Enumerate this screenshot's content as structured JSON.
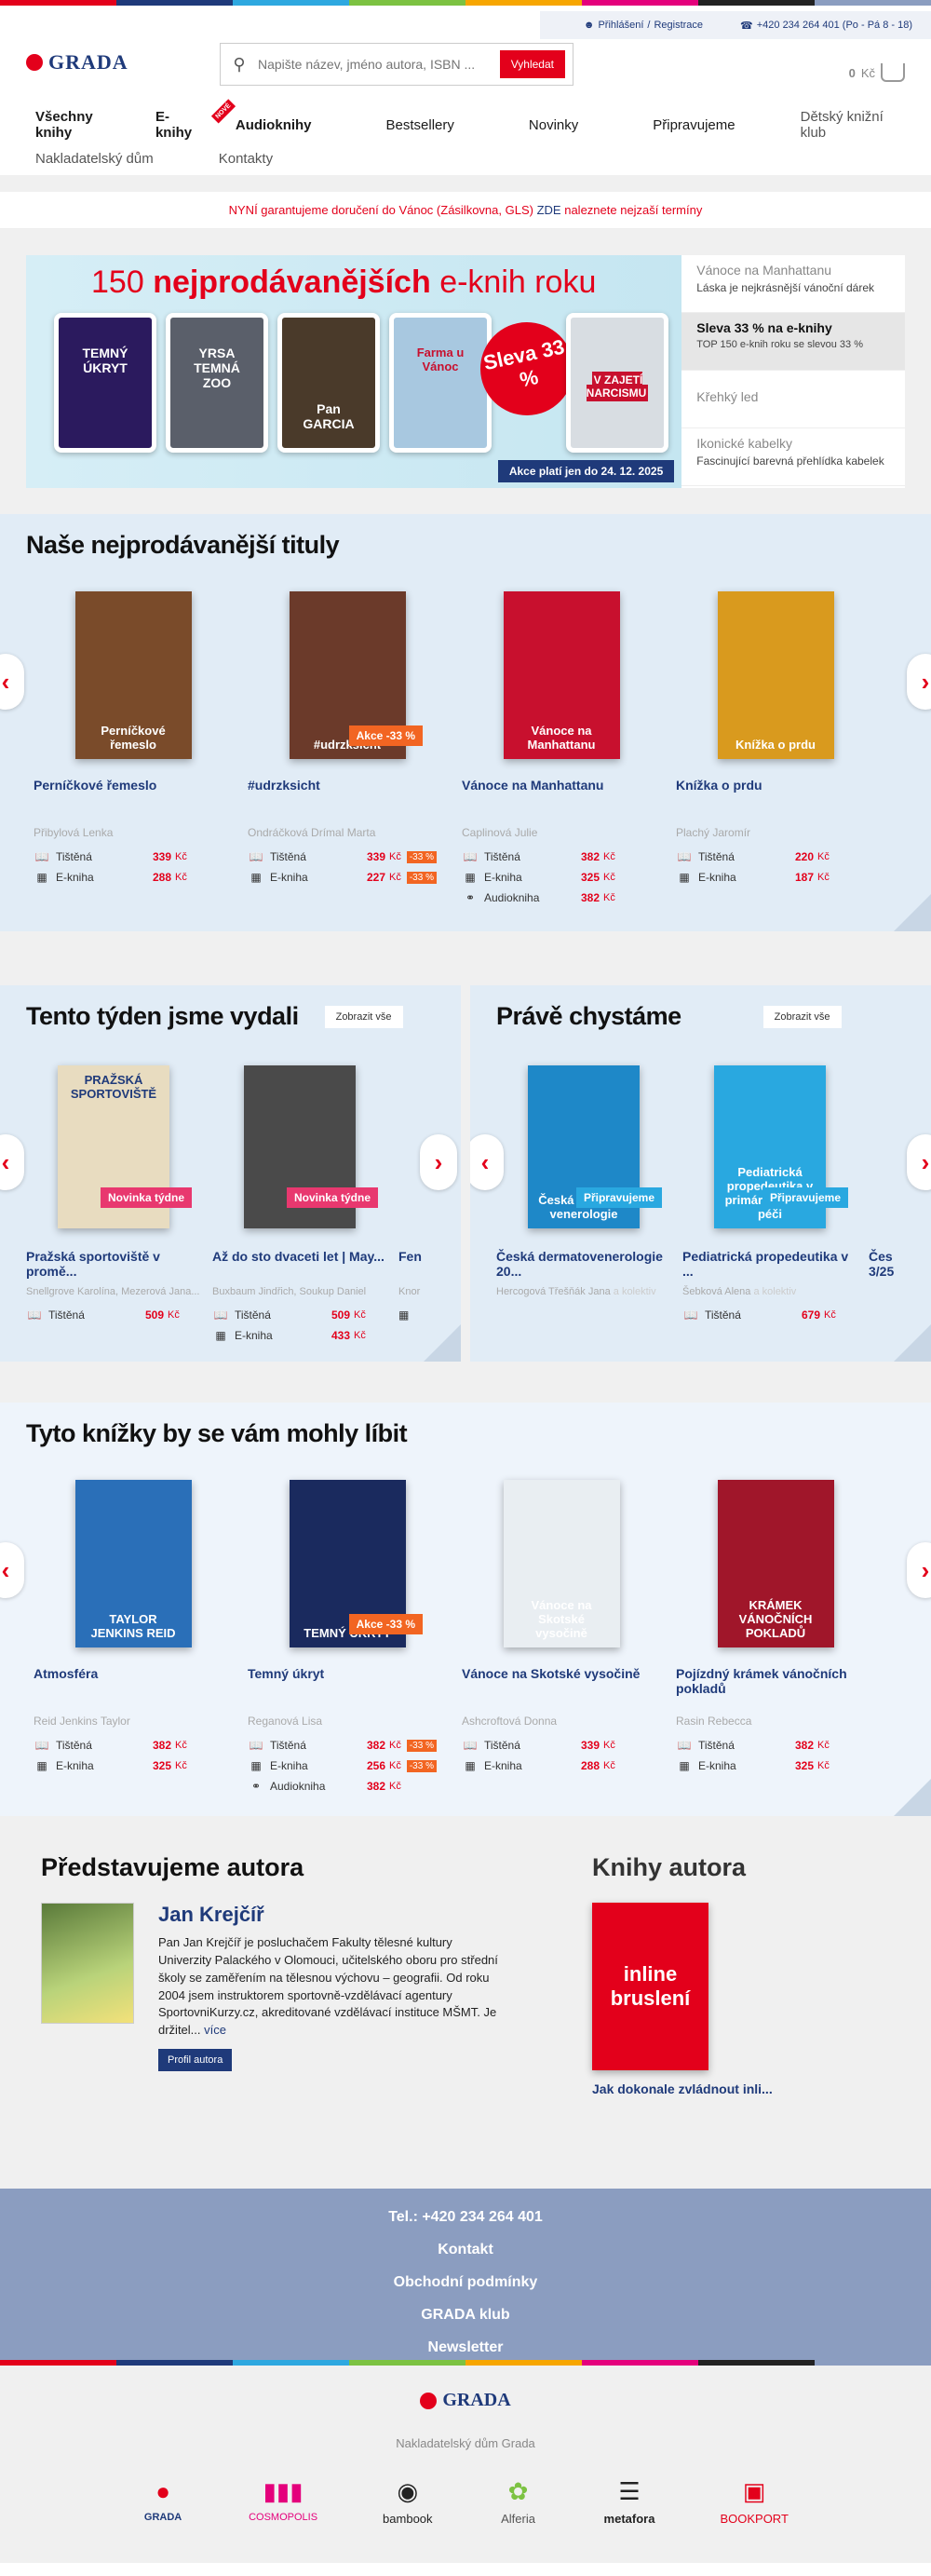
{
  "top": {
    "login": "Přihlášení",
    "separator": "/",
    "register": "Registrace",
    "phone": "+420 234 264 401 (Po - Pá 8 - 18)"
  },
  "header": {
    "logo": "GRADA",
    "search_placeholder": "Napište název, jméno autora, ISBN ...",
    "search_button": "Vyhledat",
    "cart_amount": "0",
    "cart_currency": "Kč"
  },
  "nav": {
    "row1": [
      "Všechny knihy",
      "E-knihy",
      "Audioknihy",
      "Bestsellery",
      "Novinky",
      "Připravujeme",
      "Dětský knižní klub"
    ],
    "new_badge": "NOVÉ",
    "row2": [
      "Nakladatelský dům",
      "Kontakty"
    ]
  },
  "notice": {
    "text": "NYNÍ garantujeme doručení do Vánoc (Zásilkovna, GLS)",
    "link": "ZDE",
    "rest": "naleznete nejzaší termíny"
  },
  "hero": {
    "title_pre": "150",
    "title_bold": "nejprodávanějších",
    "title_post": "e-knih roku",
    "badge": "Sleva 33 %",
    "note": "Akce platí jen do 24. 12. 2025",
    "books": [
      "TEMNÝ ÚKRYT",
      "YRSA TEMNÁ ZOO",
      "Pan GARCIA",
      "Farma u Vánoc",
      "V ZAJETÍ NARCISMU"
    ],
    "tabs": [
      {
        "title": "Vánoce na Manhattanu",
        "sub": "Láska je nejkrásnější vánoční dárek"
      },
      {
        "title": "Sleva 33 % na e-knihy",
        "sub": "TOP 150 e-knih roku se slevou 33 %"
      },
      {
        "title": "Křehký led",
        "sub": ""
      },
      {
        "title": "Ikonické kabelky",
        "sub": "Fascinující barevná přehlídka kabelek"
      }
    ]
  },
  "bestsellers": {
    "heading": "Naše nejprodávanější tituly",
    "items": [
      {
        "title": "Perníčkové řemeslo",
        "author": "Přibylová Lenka",
        "cover_text": "Perníčkové řemeslo",
        "color": "#7a4b2a",
        "akce": "",
        "prices": [
          {
            "type": "Tištěná",
            "price": "339",
            "disc": ""
          },
          {
            "type": "E-kniha",
            "price": "288",
            "disc": ""
          }
        ]
      },
      {
        "title": "#udrzksicht",
        "author": "Ondráčková Drímal Marta",
        "cover_text": "#udrzksicht",
        "color": "#6b3a2a",
        "akce": "Akce -33 %",
        "prices": [
          {
            "type": "Tištěná",
            "price": "339",
            "disc": "-33 %"
          },
          {
            "type": "E-kniha",
            "price": "227",
            "disc": "-33 %"
          }
        ]
      },
      {
        "title": "Vánoce na Manhattanu",
        "author": "Caplinová Julie",
        "cover_text": "Vánoce na Manhattanu",
        "color": "#c8102e",
        "akce": "",
        "prices": [
          {
            "type": "Tištěná",
            "price": "382",
            "disc": ""
          },
          {
            "type": "E-kniha",
            "price": "325",
            "disc": ""
          },
          {
            "type": "Audiokniha",
            "price": "382",
            "disc": ""
          }
        ]
      },
      {
        "title": "Knížka o prdu",
        "author": "Plachý Jaromír",
        "cover_text": "Knížka o prdu",
        "color": "#d99a1e",
        "akce": "",
        "prices": [
          {
            "type": "Tištěná",
            "price": "220",
            "disc": ""
          },
          {
            "type": "E-kniha",
            "price": "187",
            "disc": ""
          }
        ]
      }
    ]
  },
  "this_week": {
    "heading": "Tento týden jsme vydali",
    "button": "Zobrazit vše",
    "tag": "Novinka týdne",
    "items": [
      {
        "title": "Pražská sportoviště v promě...",
        "author": "Snellgrove Karolína, Mezerová Jana...",
        "cover_text": "PRAŽSKÁ SPORTOVIŠTĚ",
        "color": "#e8dcc0",
        "prices": [
          {
            "type": "Tištěná",
            "price": "509"
          }
        ]
      },
      {
        "title": "Až do sto dvaceti let | May...",
        "author": "Buxbaum Jindřich, Soukup Daniel",
        "cover_text": "",
        "color": "#4a4a4a",
        "prices": [
          {
            "type": "Tištěná",
            "price": "509"
          },
          {
            "type": "E-kniha",
            "price": "433"
          }
        ]
      },
      {
        "title": "Fen",
        "author": "Knor",
        "cover_text": "",
        "color": "#999",
        "prices": [
          {
            "type": "",
            "price": ""
          }
        ]
      }
    ]
  },
  "upcoming": {
    "heading": "Právě chystáme",
    "button": "Zobrazit vše",
    "tag": "Připravujeme",
    "items": [
      {
        "title": "Česká dermatovenerologie 20...",
        "author_main": "Hercogová Třešňák Jana",
        "author_more": "a kolektiv",
        "cover_text": "Česká dermato-venerologie",
        "color": "#1e88c8",
        "prices": []
      },
      {
        "title": "Pediatrická propedeutika v ...",
        "author_main": "Šebková Alena",
        "author_more": "a kolektiv",
        "cover_text": "Pediatrická propedeutika v primární dětské péči",
        "color": "#29a8e0",
        "prices": [
          {
            "type": "Tištěná",
            "price": "679"
          }
        ]
      },
      {
        "title": "Čes 3/25",
        "author_main": "",
        "author_more": "",
        "cover_text": "",
        "color": "#999",
        "prices": []
      }
    ]
  },
  "recommended": {
    "heading": "Tyto knížky by se vám mohly líbit",
    "items": [
      {
        "title": "Atmosféra",
        "author": "Reid Jenkins Taylor",
        "cover_text": "TAYLOR JENKINS REID",
        "color": "#2a6fb8",
        "akce": "",
        "prices": [
          {
            "type": "Tištěná",
            "price": "382",
            "disc": ""
          },
          {
            "type": "E-kniha",
            "price": "325",
            "disc": ""
          }
        ]
      },
      {
        "title": "Temný úkryt",
        "author": "Reganová Lisa",
        "cover_text": "TEMNÝ ÚKRYT",
        "color": "#1a2a5e",
        "akce": "Akce -33 %",
        "prices": [
          {
            "type": "Tištěná",
            "price": "382",
            "disc": "-33 %"
          },
          {
            "type": "E-kniha",
            "price": "256",
            "disc": "-33 %"
          },
          {
            "type": "Audiokniha",
            "price": "382",
            "disc": ""
          }
        ]
      },
      {
        "title": "Vánoce na Skotské vysočině",
        "author": "Ashcroftová Donna",
        "cover_text": "Vánoce na Skotské vysočině",
        "color": "#e9eef2",
        "akce": "",
        "prices": [
          {
            "type": "Tištěná",
            "price": "339",
            "disc": ""
          },
          {
            "type": "E-kniha",
            "price": "288",
            "disc": ""
          }
        ]
      },
      {
        "title": "Pojízdný krámek vánočních pokladů",
        "author": "Rasin Rebecca",
        "cover_text": "KRÁMEK VÁNOČNÍCH POKLADŮ",
        "color": "#a0162a",
        "akce": "",
        "prices": [
          {
            "type": "Tištěná",
            "price": "382",
            "disc": ""
          },
          {
            "type": "E-kniha",
            "price": "325",
            "disc": ""
          }
        ]
      }
    ]
  },
  "author": {
    "heading": "Představujeme autora",
    "name": "Jan Krejčíř",
    "bio": "Pan Jan Krejčíř je posluchačem Fakulty tělesné kultury Univerzity Palackého v Olomouci, učitelského oboru pro střední školy se zaměřením na tělesnou výchovu – geografii. Od roku 2004 jsem instruktorem sportovně-vzdělávací agentury SportovniKurzy.cz, akreditované vzdělávací instituce MŠMT. Je držitel...",
    "more": "více",
    "profile_button": "Profil autora",
    "books_heading": "Knihy autora",
    "book_title": "Jak dokonale zvládnout inli...",
    "book_cover": "inline bruslení"
  },
  "footer": {
    "links": [
      "Tel.: +420 234 264 401",
      "Kontakt",
      "Obchodní podmínky",
      "GRADA klub",
      "Newsletter"
    ],
    "logo": "GRADA",
    "subtitle": "Nakladatelský dům Grada",
    "brands": [
      "GRADA",
      "COSMOPOLIS",
      "bambook",
      "Alferia",
      "metafora",
      "BOOKPORT"
    ]
  },
  "currency": "Kč"
}
